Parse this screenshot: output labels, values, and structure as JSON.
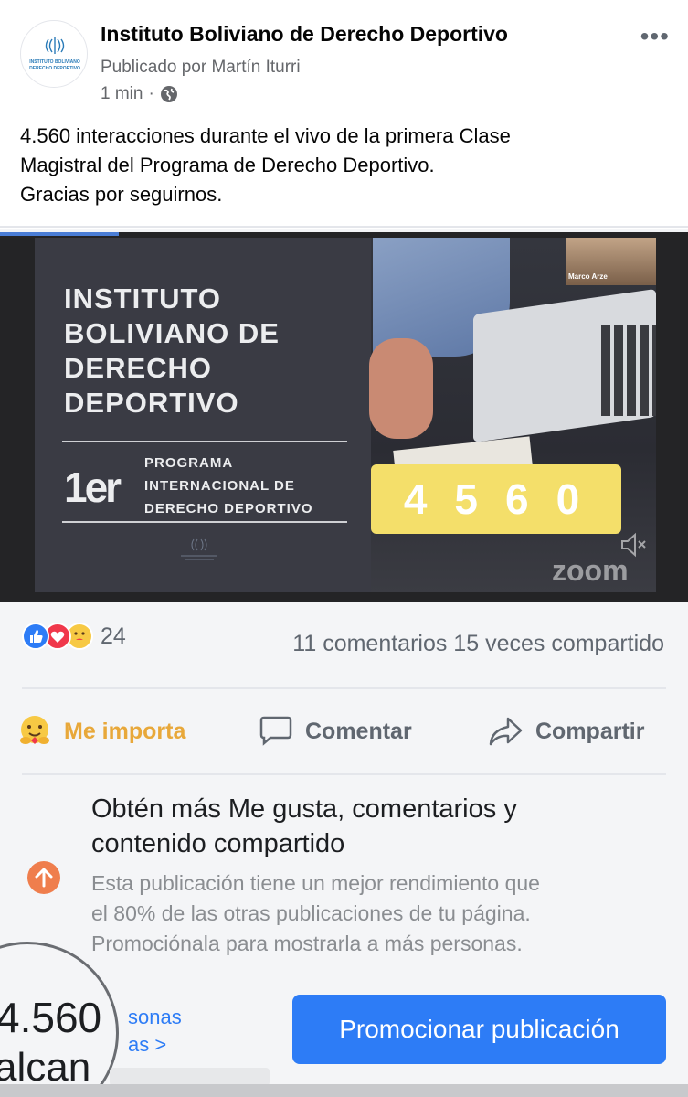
{
  "post": {
    "page_name": "Instituto Boliviano de Derecho Deportivo",
    "posted_by": "Publicado por Martín Iturri",
    "time": "1 min",
    "separator": "·",
    "more": "•••",
    "avatar_text_line1": "INSTITUTO BOLIVIANO",
    "avatar_text_line2": "DERECHO DEPORTIVO",
    "text_lines": [
      "4.560 interacciones durante el vivo de la primera Clase",
      "Magistral del Programa de Derecho Deportivo.",
      "Gracias por seguirnos."
    ]
  },
  "video": {
    "slide_title_lines": [
      "INSTITUTO",
      "BOLIVIANO DE",
      "DERECHO",
      "DEPORTIVO"
    ],
    "ordinal": "1er",
    "program_lines": [
      "PROGRAMA",
      "INTERNACIONAL DE",
      "DERECHO DEPORTIVO"
    ],
    "counter": "4560",
    "participant_name": "Marco Arze",
    "watermark": "zoom"
  },
  "stats": {
    "reaction_count": "24",
    "comments_shares": "11 comentarios 15 veces compartido"
  },
  "actions": {
    "like_label": "Me importa",
    "comment_label": "Comentar",
    "share_label": "Compartir"
  },
  "promo": {
    "title_lines": [
      "Obtén más Me gusta, comentarios y",
      "contenido compartido"
    ],
    "body_lines": [
      "Esta publicación tiene un mejor rendimiento que",
      "el 80% de las otras publicaciones de tu página.",
      "Promociónala para mostrarla a más personas."
    ],
    "reach_number": "4.560",
    "reach_word": "alcan",
    "people_lines": [
      "sonas",
      "as >"
    ],
    "button_label": "Promocionar publicación"
  },
  "colors": {
    "facebook_blue": "#2d7cf6",
    "care_yellow": "#e8a83a",
    "counter_yellow": "#f4df6a",
    "promo_orange": "#ef7e4d"
  }
}
